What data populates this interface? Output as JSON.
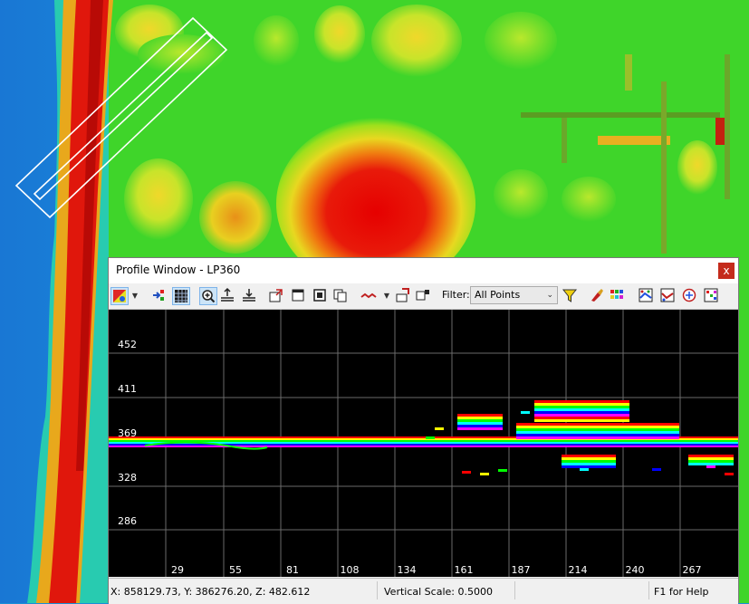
{
  "window": {
    "title": "Profile Window - LP360",
    "close_label": "x"
  },
  "toolbar": {
    "filter_label": "Filter:",
    "filter_value": "All Points"
  },
  "profile": {
    "y_ticks": [
      "452",
      "411",
      "369",
      "328",
      "286"
    ],
    "x_ticks": [
      "29",
      "55",
      "81",
      "108",
      "134",
      "161",
      "187",
      "214",
      "240",
      "267"
    ]
  },
  "status": {
    "coords": "X: 858129.73, Y: 386276.20, Z: 482.612",
    "vertical_scale": "Vertical Scale: 0.5000",
    "help": "F1 for Help"
  },
  "colors": {
    "window_bg": "#f0f0f0",
    "plot_bg": "#000000",
    "close": "#c42b1c",
    "selected": "#cce4f7"
  }
}
